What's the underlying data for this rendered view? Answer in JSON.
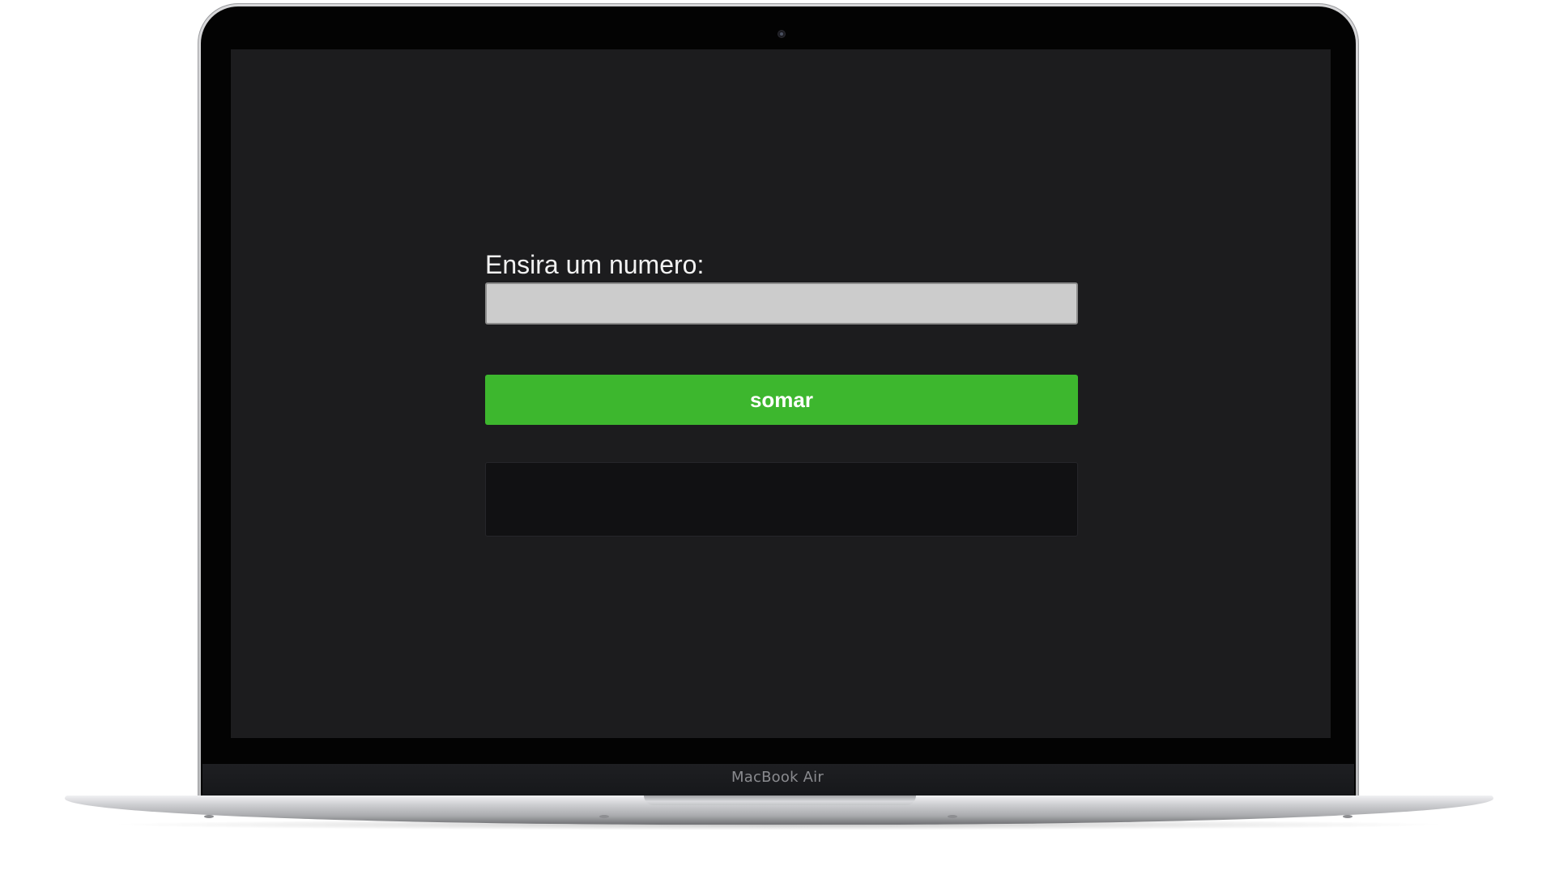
{
  "device": {
    "brand_label": "MacBook Air"
  },
  "app": {
    "input_label": "Ensira um numero:",
    "input_value": "",
    "input_placeholder": "",
    "button_label": "somar",
    "result_text": ""
  },
  "colors": {
    "screen_background": "#1c1c1e",
    "input_background": "#cccccc",
    "button_background": "#3db72e",
    "result_background": "#111113"
  }
}
